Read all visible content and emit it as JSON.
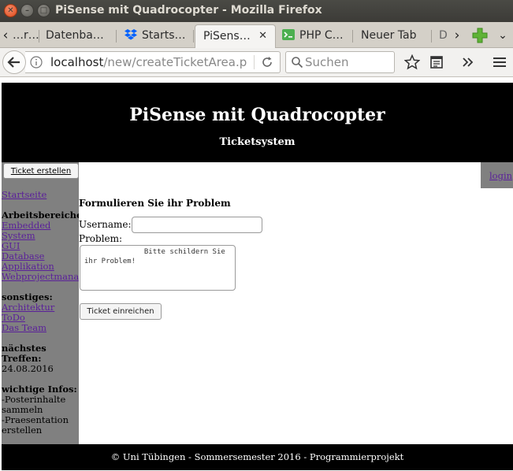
{
  "window": {
    "title": "PiSense mit Quadrocopter - Mozilla Firefox"
  },
  "tabs": [
    {
      "label": "…r…",
      "icon": "none"
    },
    {
      "label": "Datenba…",
      "icon": "none"
    },
    {
      "label": "Starts…",
      "icon": "dropbox-icon"
    },
    {
      "label": "PiSens…",
      "icon": "none",
      "active": true
    },
    {
      "label": "PHP C…",
      "icon": "php-icon"
    },
    {
      "label": "Neuer Tab",
      "icon": "none"
    },
    {
      "label": "D",
      "icon": "none"
    }
  ],
  "navbar": {
    "url_host": "localhost",
    "url_path": "/new/createTicketArea.p",
    "search_placeholder": "Suchen"
  },
  "colors": {
    "link": "#5a1f9a",
    "header_bg": "#000000",
    "sidebar_bg": "#808080",
    "dropbox": "#0061fe",
    "php_green": "#4caf50",
    "firefox_orange": "#e04b1c"
  },
  "site": {
    "title": "PiSense mit Quadrocopter",
    "subtitle": "Ticketsystem",
    "login_label": "login",
    "footer": "© Uni Tübingen - Sommersemester 2016 - Programmierprojekt"
  },
  "sidebar": {
    "ticket_button": "Ticket erstellen",
    "startseite": "Startseite",
    "areas_heading": "Arbeitsbereiche",
    "areas": [
      "Embedded",
      "System",
      "GUI",
      "Database",
      "Applikation",
      "Webprojectmanager"
    ],
    "other_heading": "sonstiges:",
    "other": [
      "Architektur",
      "ToDo",
      "Das Team"
    ],
    "meeting_heading_1": "nächstes",
    "meeting_heading_2": "Treffen:",
    "meeting_date": "24.08.2016",
    "infos_heading": "wichtige Infos:",
    "infos": [
      "-Posterinhalte",
      "sammeln",
      "-Praesentation",
      "erstellen"
    ]
  },
  "form": {
    "heading": "Formulieren Sie ihr Problem",
    "username_label": "Username:",
    "username_value": "",
    "problem_label": "Problem:",
    "problem_placeholder": "              Bitte schildern Sie ihr Problem!",
    "submit_label": "Ticket einreichen"
  }
}
